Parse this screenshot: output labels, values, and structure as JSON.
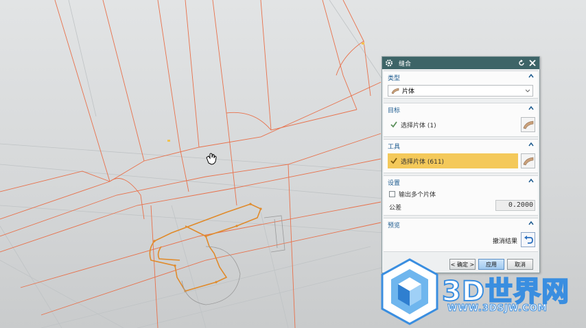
{
  "dialog": {
    "title": "缝合",
    "groups": {
      "type": {
        "header": "类型",
        "value": "片体"
      },
      "target": {
        "header": "目标",
        "select_label": "选择片体 (1)"
      },
      "tool": {
        "header": "工具",
        "select_label": "选择片体 (611)"
      },
      "settings": {
        "header": "设置",
        "multi_sheet_label": "输出多个片体",
        "tolerance_label": "公差",
        "tolerance_value": "0.2000"
      },
      "preview": {
        "header": "预览",
        "undo_label": "撤消结果"
      }
    },
    "buttons": {
      "ok": "< 确定 >",
      "apply": "应用",
      "cancel": "取消"
    }
  },
  "watermark": {
    "brand": "3D世界网",
    "url": "WWW.3DSJW.COM"
  },
  "colors": {
    "titlebar": "#3d6467",
    "header_text": "#1d5b8f",
    "active_selection": "#f4c95a",
    "model_edges": "#e8704a",
    "highlight": "#e08a2a"
  },
  "icons": {
    "title": "gear-icon",
    "reset": "reset-icon",
    "close": "close-icon",
    "collapse": "chevron-up-icon",
    "sheet": "sheet-body-icon",
    "undo": "undo-icon",
    "cursor": "hand-cursor-icon"
  }
}
